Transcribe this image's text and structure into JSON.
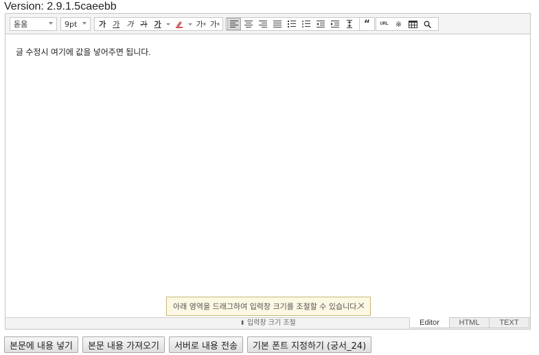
{
  "version_label": "Version: 2.9.1.5caeebb",
  "toolbar": {
    "font_family": "돋움",
    "font_size": "9pt",
    "bold": "가",
    "underline": "가",
    "italic": "가",
    "strike": "가",
    "text_color": "가",
    "superscript": "가",
    "superscript_mark": "x",
    "subscript": "가",
    "subscript_mark": "x",
    "quote": "“",
    "url": "URL",
    "special_char": "※",
    "table": "▦",
    "find": "⚲"
  },
  "content": {
    "text": "글 수정시 여기에 값을 넣어주면 됩니다."
  },
  "tooltip": {
    "text": "아래 영역을 드래그하여 입력창 크기를 조절할 수 있습니다.",
    "close": "✕"
  },
  "resize_bar": {
    "icon": "⬍",
    "label": "입력창 크기 조절"
  },
  "modes": {
    "editor": "Editor",
    "html": "HTML",
    "text": "TEXT"
  },
  "actions": {
    "insert": "본문에 내용 넣기",
    "fetch": "본문 내용 가져오기",
    "send": "서버로 내용 전송",
    "set_font": "기본 폰트 지정하기 (궁서_24)"
  }
}
